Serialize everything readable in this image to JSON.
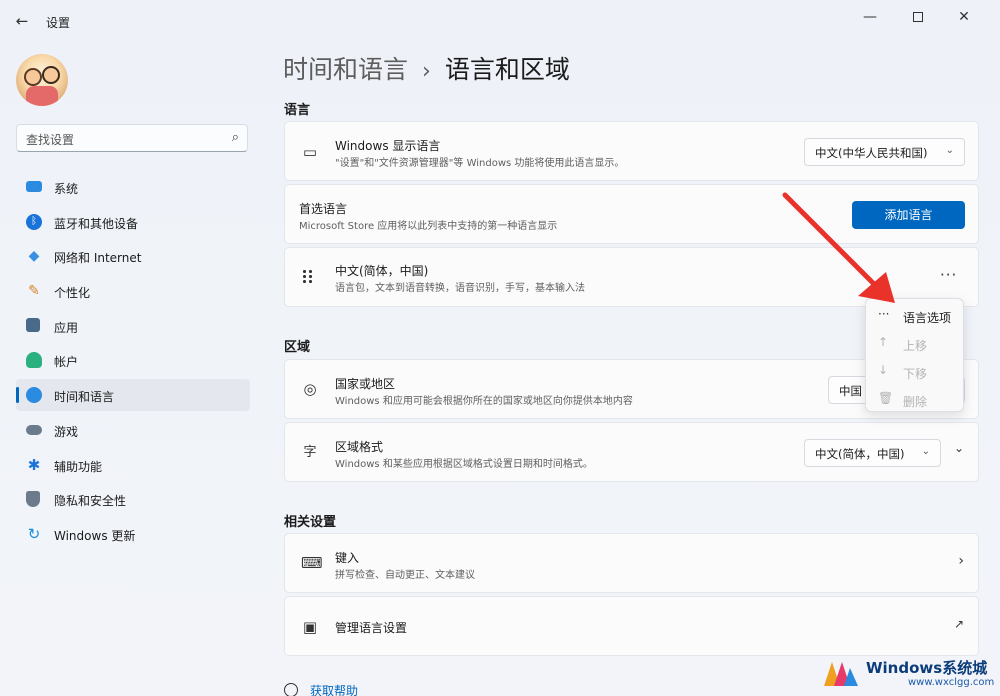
{
  "window": {
    "title": "设置",
    "controls": {
      "minimize": "—",
      "close": "✕"
    }
  },
  "sidebar": {
    "search_placeholder": "查找设置",
    "items": [
      {
        "label": "系统",
        "icon": "monitor-icon",
        "color": "#2b8be0"
      },
      {
        "label": "蓝牙和其他设备",
        "icon": "bluetooth-icon",
        "color": "#1a73d9"
      },
      {
        "label": "网络和 Internet",
        "icon": "wifi-icon",
        "color": "#3a8fe0"
      },
      {
        "label": "个性化",
        "icon": "brush-icon",
        "color": "#d9822b"
      },
      {
        "label": "应用",
        "icon": "apps-icon",
        "color": "#4a6a8a"
      },
      {
        "label": "帐户",
        "icon": "account-icon",
        "color": "#2bb07f"
      },
      {
        "label": "时间和语言",
        "icon": "globe-clock-icon",
        "color": "#2b8be0",
        "active": true
      },
      {
        "label": "游戏",
        "icon": "gamepad-icon",
        "color": "#6b7b8c"
      },
      {
        "label": "辅助功能",
        "icon": "accessibility-icon",
        "color": "#1a73d9"
      },
      {
        "label": "隐私和安全性",
        "icon": "shield-icon",
        "color": "#6b7b8c"
      },
      {
        "label": "Windows 更新",
        "icon": "update-icon",
        "color": "#1a8fd9"
      }
    ]
  },
  "breadcrumb": {
    "parent": "时间和语言",
    "separator": "›",
    "current": "语言和区域"
  },
  "language_section": {
    "heading": "语言",
    "display_language": {
      "title": "Windows 显示语言",
      "subtitle": "\"设置\"和\"文件资源管理器\"等 Windows 功能将使用此语言显示。",
      "value": "中文(中华人民共和国)"
    },
    "preferred": {
      "title": "首选语言",
      "subtitle": "Microsoft Store 应用将以此列表中支持的第一种语言显示",
      "button": "添加语言"
    },
    "installed": {
      "title": "中文(简体，中国)",
      "subtitle": "语言包，文本到语音转换，语音识别，手写，基本输入法",
      "more": "···"
    }
  },
  "context_menu": {
    "items": [
      {
        "icon": "more-icon",
        "glyph": "···",
        "label": "语言选项",
        "enabled": true
      },
      {
        "icon": "arrow-up-icon",
        "glyph": "↑",
        "label": "上移",
        "enabled": false
      },
      {
        "icon": "arrow-down-icon",
        "glyph": "↓",
        "label": "下移",
        "enabled": false
      },
      {
        "icon": "trash-icon",
        "glyph": "🗑",
        "label": "删除",
        "enabled": false
      }
    ]
  },
  "region_section": {
    "heading": "区域",
    "country": {
      "title": "国家或地区",
      "subtitle": "Windows 和应用可能会根据你所在的国家或地区向你提供本地内容",
      "value": "中国"
    },
    "format": {
      "title": "区域格式",
      "subtitle": "Windows 和某些应用根据区域格式设置日期和时间格式。",
      "value": "中文(简体，中国)"
    }
  },
  "related_section": {
    "heading": "相关设置",
    "keyboard": {
      "title": "键入",
      "subtitle": "拼写检查、自动更正、文本建议"
    },
    "manage": {
      "title": "管理语言设置"
    }
  },
  "help": {
    "label": "获取帮助"
  },
  "watermark": {
    "title": "Windows系统城",
    "url": "www.wxclgg.com"
  },
  "colors": {
    "accent": "#0067c0",
    "annotation": "#e8322a"
  }
}
